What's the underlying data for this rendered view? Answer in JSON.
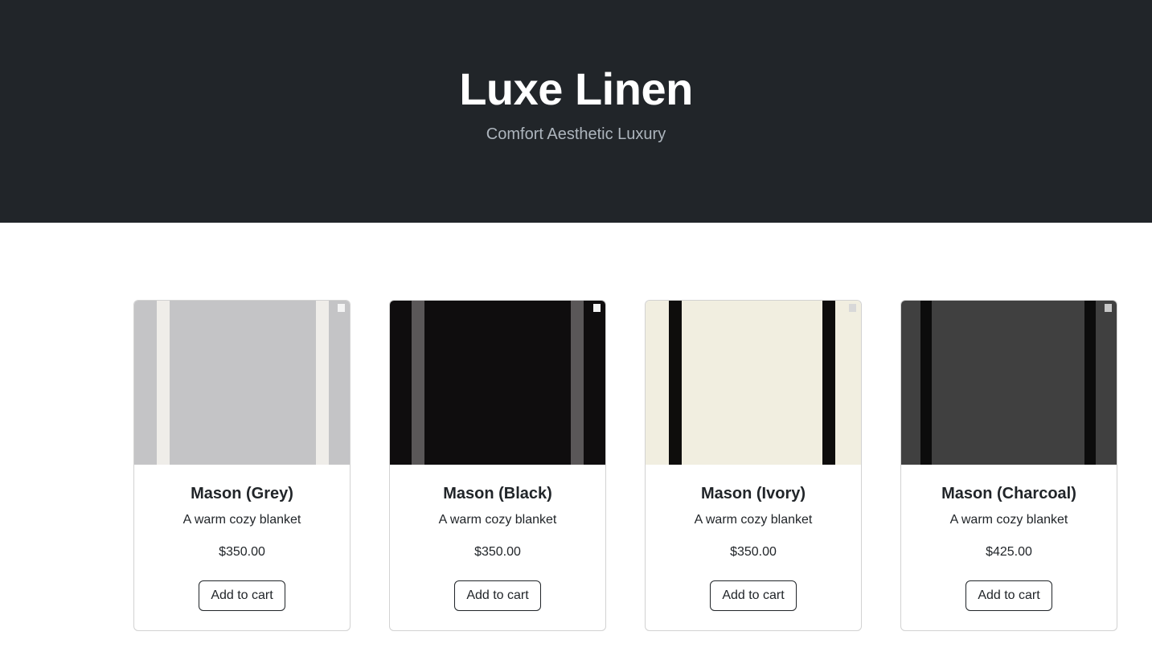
{
  "header": {
    "title": "Luxe Linen",
    "tagline": "Comfort Aesthetic Luxury"
  },
  "products": [
    {
      "name": "Mason (Grey)",
      "description": "A warm cozy blanket",
      "price": "$350.00",
      "button_label": "Add to cart",
      "colors": {
        "base": "#c4c4c6",
        "stripe": "#efede9",
        "tag": "#f4f4f4"
      }
    },
    {
      "name": "Mason (Black)",
      "description": "A warm cozy blanket",
      "price": "$350.00",
      "button_label": "Add to cart",
      "colors": {
        "base": "#0f0d0e",
        "stripe": "#5a5758",
        "tag": "#f4f4f4"
      }
    },
    {
      "name": "Mason (Ivory)",
      "description": "A warm cozy blanket",
      "price": "$350.00",
      "button_label": "Add to cart",
      "colors": {
        "base": "#f1eee0",
        "stripe": "#0e0d0c",
        "tag": "#d8d8d8"
      }
    },
    {
      "name": "Mason (Charcoal)",
      "description": "A warm cozy blanket",
      "price": "$425.00",
      "button_label": "Add to cart",
      "colors": {
        "base": "#404040",
        "stripe": "#0c0c0c",
        "tag": "#c8c8c8"
      }
    }
  ]
}
